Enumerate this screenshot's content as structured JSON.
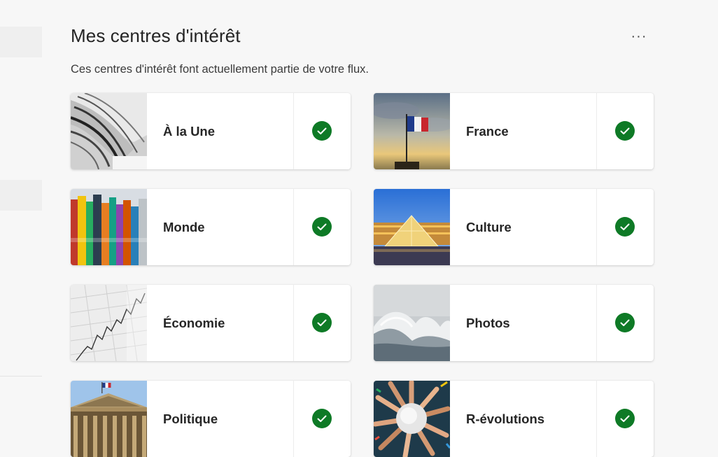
{
  "header": {
    "title": "Mes centres d'intérêt",
    "more_label": "···",
    "subtitle": "Ces centres d'intérêt font actuellement partie de votre flux."
  },
  "colors": {
    "check": "#0e7a26",
    "background": "#f7f7f7"
  },
  "interests": [
    {
      "label": "À la Une",
      "image": "newspaper-stack-image",
      "selected": true
    },
    {
      "label": "France",
      "image": "french-flag-image",
      "selected": true
    },
    {
      "label": "Monde",
      "image": "world-flags-image",
      "selected": true
    },
    {
      "label": "Culture",
      "image": "louvre-pyramid-image",
      "selected": true
    },
    {
      "label": "Économie",
      "image": "stock-chart-image",
      "selected": true
    },
    {
      "label": "Photos",
      "image": "ocean-wave-image",
      "selected": true
    },
    {
      "label": "Politique",
      "image": "assemblee-building-image",
      "selected": true
    },
    {
      "label": "R-évolutions",
      "image": "hands-circle-image",
      "selected": true
    }
  ]
}
